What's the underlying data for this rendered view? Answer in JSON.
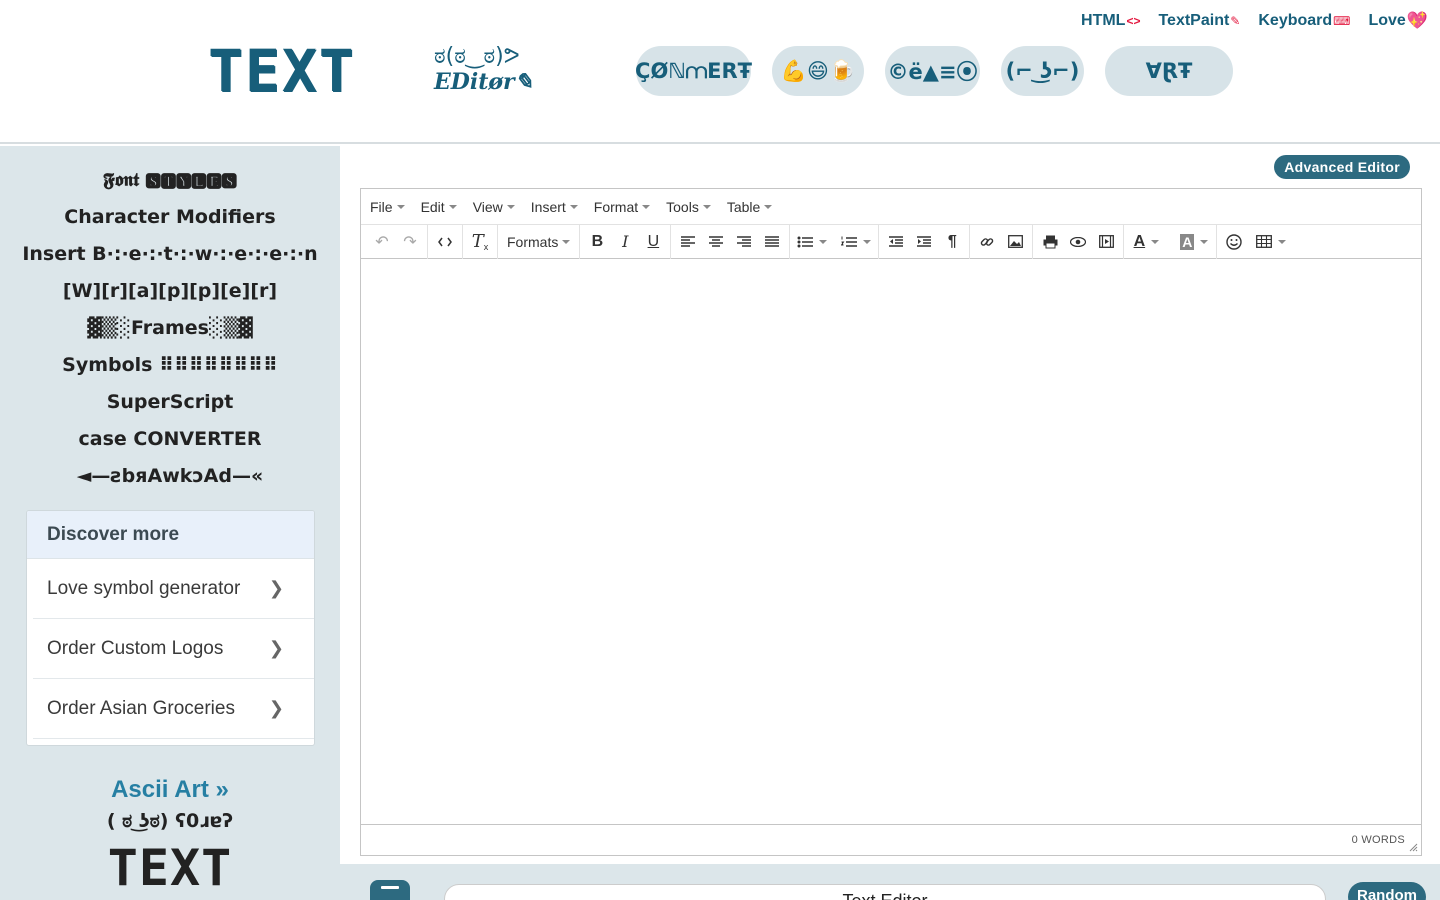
{
  "header": {
    "logo_big": "TEXT",
    "logo_face": "ಠ(ಠ‿ಠ)ᕗ",
    "logo_sub": "EDitør✎",
    "top_links": [
      {
        "label": "HTML",
        "mark": "<>"
      },
      {
        "label": "TextPaint",
        "mark": "✎"
      },
      {
        "label": "Keyboard",
        "mark": "⌨"
      },
      {
        "label": "Love",
        "mark": "💖"
      }
    ],
    "pills": [
      "ÇØℕ⩋ERŦ",
      "💪😄🍺",
      "©ë▲≡⦿",
      "(⌐ ͜ʖ⌐)",
      "ⱯⱤŦ"
    ]
  },
  "sidebar": {
    "links": [
      "𝕱𝖔𝖓𝖙 🆂🆃🆈🅻🅴🆂",
      "Character Modifiers",
      "Insert B·:·e·:·t·:·w·:·e·:·e·:·n",
      "[W][r][a][p][p][e][r]",
      "▓▒░Frames░▒▓",
      "Symbols ⠿⠿⠿⠿⠿⠿⠿⠿",
      "SuperScript",
      "case CONVERTER",
      "◄—ƨbяAwkɔAd—«"
    ],
    "discover": {
      "heading": "Discover more",
      "items": [
        "Love symbol generator",
        "Order Custom Logos",
        "Order Asian Groceries"
      ]
    },
    "ascii_title": "Ascii Art »",
    "ascii_face": "( ಠ ͜ʖಠ)  ʕ0ɹɐʔ",
    "ascii_logo": "TEXT"
  },
  "main": {
    "advanced_editor": "Advanced Editor",
    "menu": [
      "File",
      "Edit",
      "View",
      "Insert",
      "Format",
      "Tools",
      "Table"
    ],
    "formats_label": "Formats",
    "word_count": "0 WORDS",
    "title_value": "Text Editor",
    "random_label": "Random"
  },
  "colors": {
    "brand": "#175e7a",
    "button": "#2d6a80",
    "sidebar_bg": "#dce6ea",
    "pill_bg": "#d7e3e8"
  }
}
